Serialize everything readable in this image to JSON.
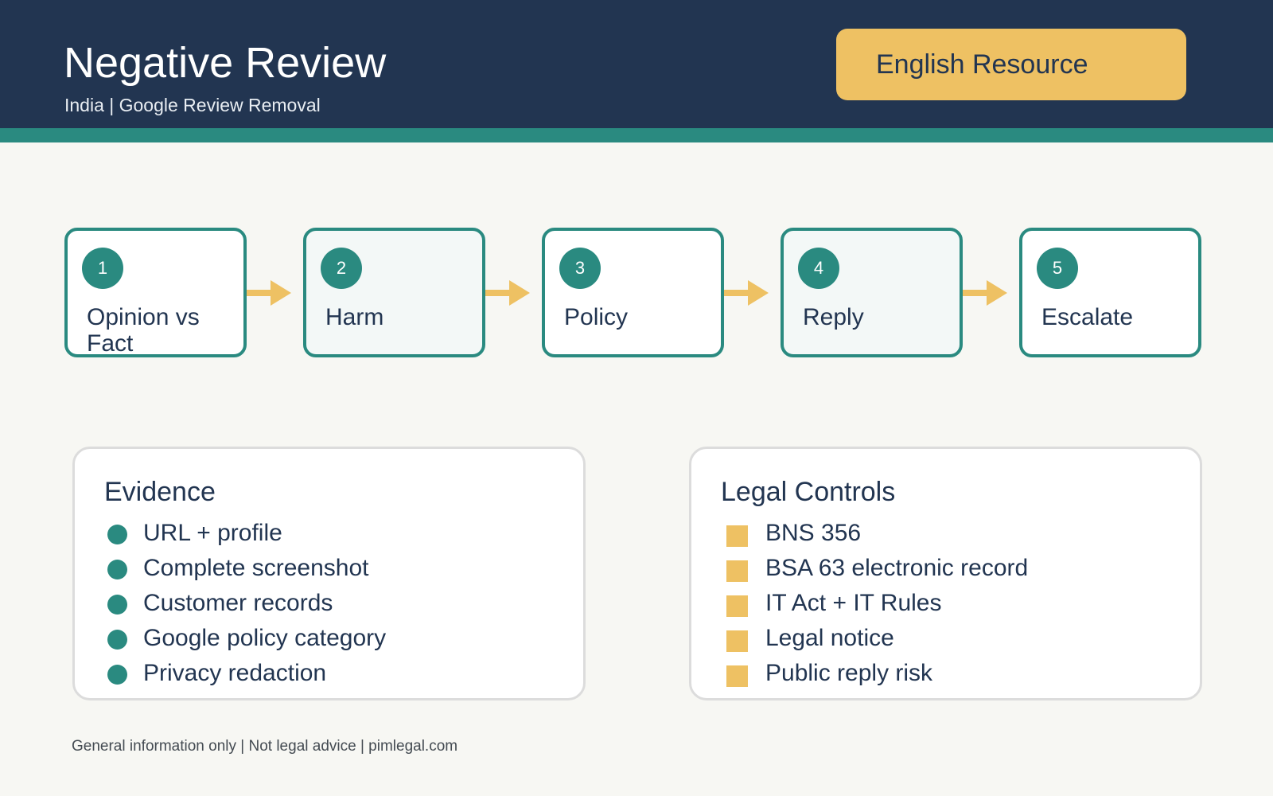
{
  "header": {
    "title": "Negative Review",
    "subtitle": "India | Google Review Removal",
    "badge": "English Resource"
  },
  "steps": [
    {
      "number": "1",
      "label": "Opinion vs Fact"
    },
    {
      "number": "2",
      "label": "Harm"
    },
    {
      "number": "3",
      "label": "Policy"
    },
    {
      "number": "4",
      "label": "Reply"
    },
    {
      "number": "5",
      "label": "Escalate"
    }
  ],
  "evidence": {
    "title": "Evidence",
    "items": [
      "URL + profile",
      "Complete screenshot",
      "Customer records",
      "Google policy category",
      "Privacy redaction"
    ]
  },
  "legal_controls": {
    "title": "Legal Controls",
    "items": [
      "BNS 356",
      "BSA 63 electronic record",
      "IT Act + IT Rules",
      "Legal notice",
      "Public reply risk"
    ]
  },
  "footer": "General information only | Not legal advice | pimlegal.com",
  "colors": {
    "navy": "#223551",
    "teal": "#2a8a80",
    "gold": "#eec163",
    "background": "#f7f7f3"
  }
}
